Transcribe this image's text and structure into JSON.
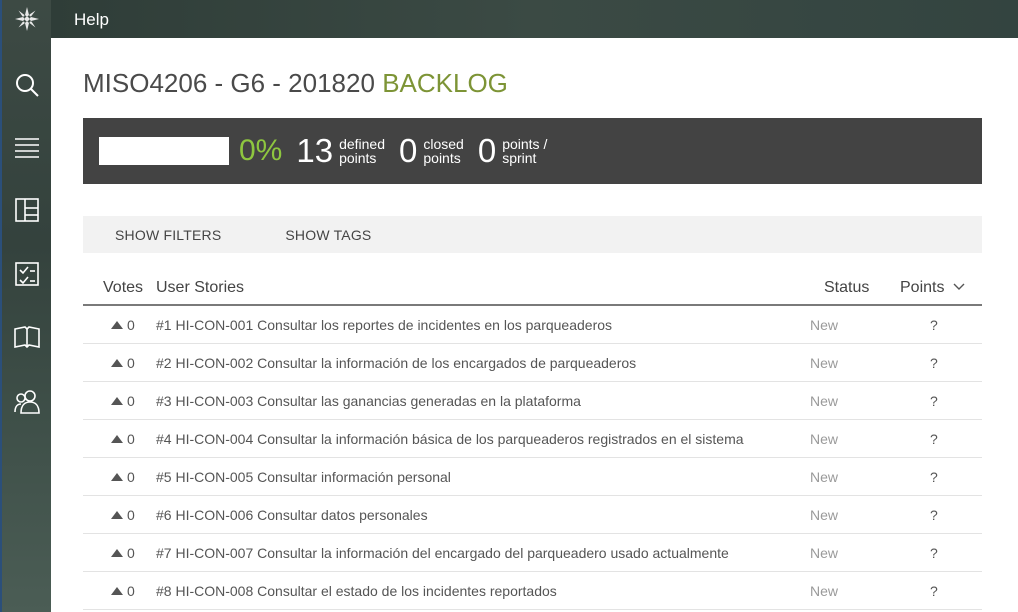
{
  "topbar": {
    "help_label": "Help"
  },
  "sidebar": {
    "items": [
      {
        "name": "search-icon"
      },
      {
        "name": "backlog-icon"
      },
      {
        "name": "kanban-icon"
      },
      {
        "name": "issues-icon"
      },
      {
        "name": "wiki-icon"
      },
      {
        "name": "team-icon"
      }
    ]
  },
  "header": {
    "project": "MISO4206 - G6 - 201820",
    "section": "BACKLOG"
  },
  "stats": {
    "progress": 0,
    "percent": "0%",
    "defined_points": "13",
    "defined_label_1": "defined",
    "defined_label_2": "points",
    "closed_points": "0",
    "closed_label_1": "closed",
    "closed_label_2": "points",
    "sprint_points": "0",
    "sprint_label_1": "points /",
    "sprint_label_2": "sprint"
  },
  "filters": {
    "show_filters": "SHOW FILTERS",
    "show_tags": "SHOW TAGS"
  },
  "table": {
    "columns": {
      "votes": "Votes",
      "stories": "User Stories",
      "status": "Status",
      "points": "Points"
    },
    "rows": [
      {
        "votes": "0",
        "story": "#1 HI-CON-001 Consultar los reportes de incidentes en los parqueaderos",
        "status": "New",
        "points": "?"
      },
      {
        "votes": "0",
        "story": "#2 HI-CON-002 Consultar la información de los encargados de parqueaderos",
        "status": "New",
        "points": "?"
      },
      {
        "votes": "0",
        "story": "#3 HI-CON-003 Consultar las ganancias generadas en la plataforma",
        "status": "New",
        "points": "?"
      },
      {
        "votes": "0",
        "story": "#4 HI-CON-004 Consultar la información básica de los parqueaderos registrados en el sistema",
        "status": "New",
        "points": "?"
      },
      {
        "votes": "0",
        "story": "#5 HI-CON-005 Consultar información personal",
        "status": "New",
        "points": "?"
      },
      {
        "votes": "0",
        "story": "#6 HI-CON-006 Consultar datos personales",
        "status": "New",
        "points": "?"
      },
      {
        "votes": "0",
        "story": "#7 HI-CON-007 Consultar la información del encargado del parqueadero usado actualmente",
        "status": "New",
        "points": "?"
      },
      {
        "votes": "0",
        "story": "#8 HI-CON-008 Consultar el estado de los incidentes reportados",
        "status": "New",
        "points": "?"
      }
    ]
  }
}
